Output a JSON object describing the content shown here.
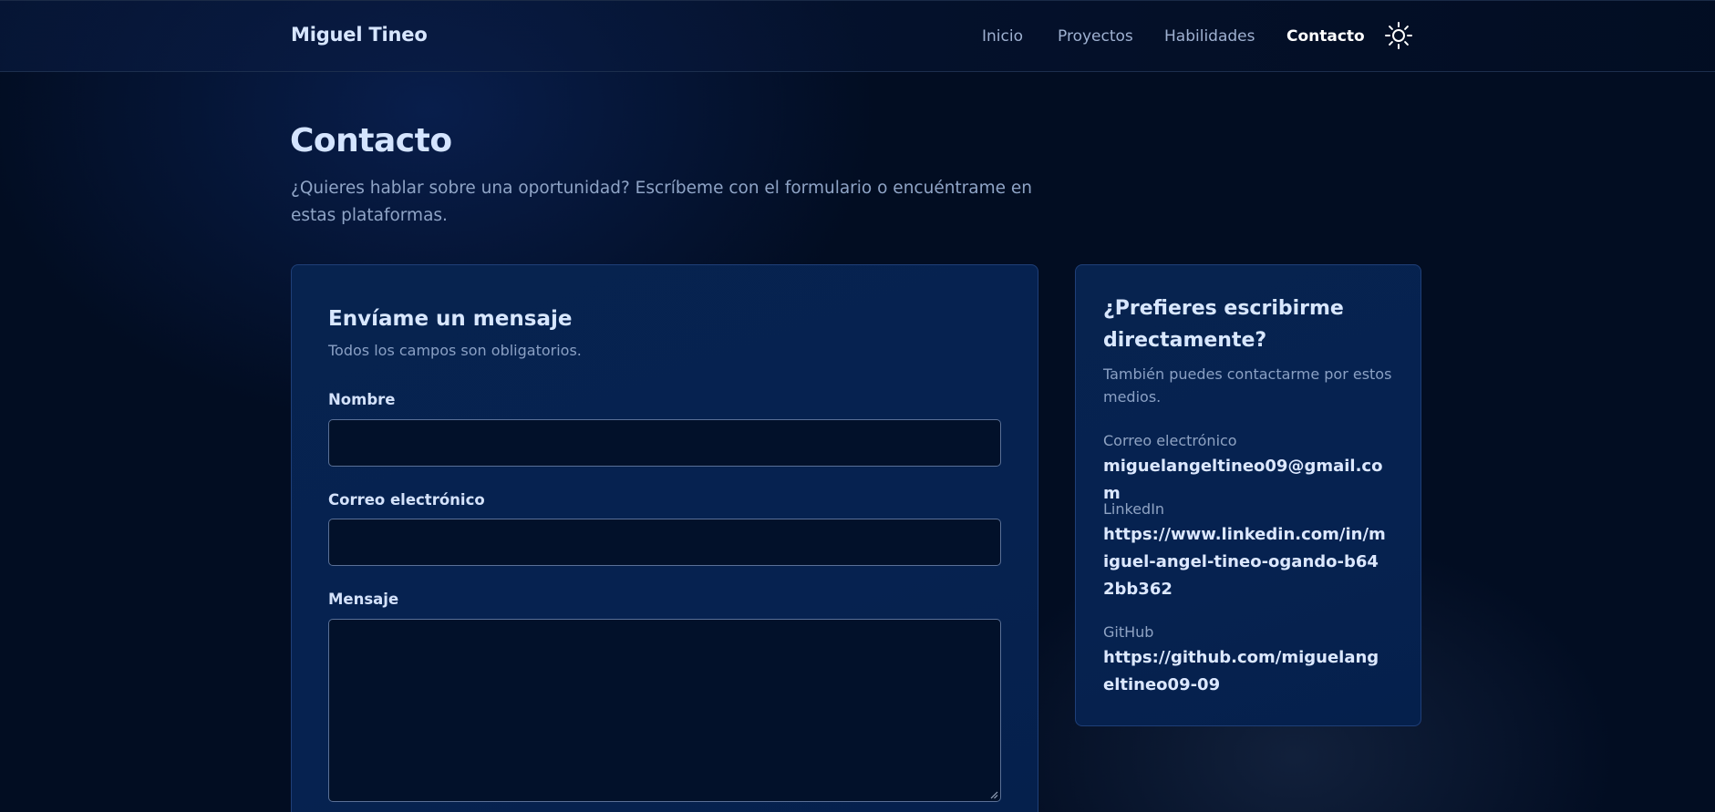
{
  "header": {
    "brand": "Miguel Tineo",
    "nav": [
      {
        "label": "Inicio",
        "active": false
      },
      {
        "label": "Proyectos",
        "active": false
      },
      {
        "label": "Habilidades",
        "active": false
      },
      {
        "label": "Contacto",
        "active": true
      }
    ],
    "theme_toggle_icon": "sun-icon"
  },
  "page": {
    "title": "Contacto",
    "subtitle": "¿Quieres hablar sobre una oportunidad? Escríbeme con el formulario o encuéntrame en estas plataformas."
  },
  "form": {
    "title": "Envíame un mensaje",
    "subtitle": "Todos los campos son obligatorios.",
    "fields": {
      "name": {
        "label": "Nombre",
        "value": ""
      },
      "email": {
        "label": "Correo electrónico",
        "value": ""
      },
      "message": {
        "label": "Mensaje",
        "value": ""
      }
    }
  },
  "direct": {
    "title": "¿Prefieres escribirme directamente?",
    "subtitle": "También puedes contactarme por estos medios.",
    "contacts": [
      {
        "label": "Correo electrónico",
        "value": "miguelangeltineo09@gmail.com"
      },
      {
        "label": "LinkedIn",
        "value": "https://www.linkedin.com/in/miguel-angel-tineo-ogando-b642bb362"
      },
      {
        "label": "GitHub",
        "value": "https://github.com/miguelangeltineo09-09"
      }
    ]
  },
  "colors": {
    "background": "#020d22",
    "card": "#062250",
    "input": "#02112a",
    "accent_text": "#d4e4ff",
    "muted_text": "#8fa4c6"
  }
}
